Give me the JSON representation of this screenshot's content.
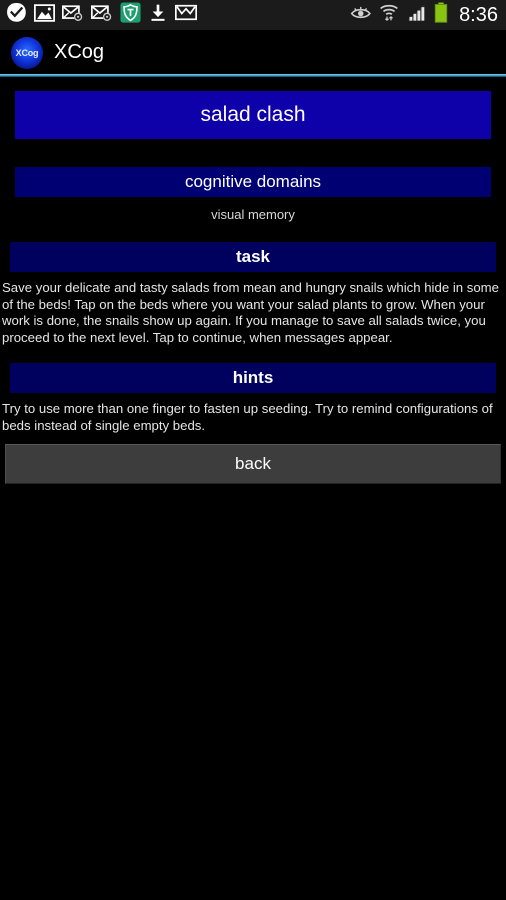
{
  "statusbar": {
    "left_icons": [
      {
        "name": "checkmark-circle-icon",
        "label": "task complete"
      },
      {
        "name": "gallery-image-icon",
        "label": "screenshot captured"
      },
      {
        "name": "email-sync-icon",
        "label": "email"
      },
      {
        "name": "email-sync-icon-2",
        "label": "email"
      },
      {
        "name": "shield-security-icon",
        "label": "security"
      },
      {
        "name": "download-icon",
        "label": "download complete"
      },
      {
        "name": "gmail-icon",
        "label": "gmail"
      }
    ],
    "right_icons": [
      {
        "name": "smart-stay-eye-icon",
        "label": "smart stay"
      },
      {
        "name": "wifi-transfer-icon",
        "label": "wifi"
      },
      {
        "name": "signal-bars-icon",
        "label": "signal"
      },
      {
        "name": "battery-icon",
        "label": "battery"
      }
    ],
    "clock": "8:36",
    "battery_color": "#8ac413",
    "accent_color": "#3d9bc7"
  },
  "appbar": {
    "logo_text": "XCog",
    "title": "XCog"
  },
  "main": {
    "game_title": "salad clash",
    "domains_header": "cognitive domains",
    "domain_value": "visual memory",
    "task_header": "task",
    "task_text": "Save your delicate and tasty salads from mean and hungry snails which hide in some of the beds! Tap on the beds where you want your salad plants to grow. When your work is done, the snails show up again. If you manage to save all salads twice, you proceed to the next level. Tap to continue, when messages appear.",
    "hints_header": "hints",
    "hints_text": "Try to use more than one finger to fasten up seeding. Try to remind configurations of beds instead of single empty beds.",
    "back_label": "back"
  },
  "colors": {
    "title_button": "#0f01aa",
    "section_button": "#000073",
    "section_button_wide": "#00005f",
    "back_button": "#3d3d3d",
    "background": "#000000"
  }
}
